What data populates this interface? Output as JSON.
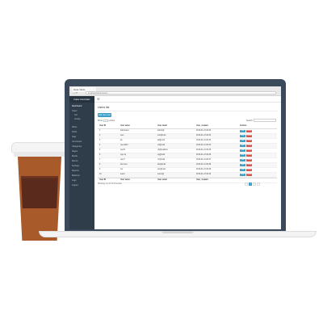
{
  "browser": {
    "tab_title": "Data Table",
    "address": "localhost/admin/users",
    "nav": "‹ › ⟳"
  },
  "sidebar": {
    "brand": "Data Controller",
    "items": [
      {
        "label": "Dashboard"
      },
      {
        "label": "Users"
      },
      {
        "label": "List"
      },
      {
        "label": "Create"
      },
      {
        "label": "Roles"
      },
      {
        "label": "Posts"
      },
      {
        "label": "Tags"
      },
      {
        "label": "Comments"
      },
      {
        "label": "Categories"
      },
      {
        "label": "Pages"
      },
      {
        "label": "Media"
      },
      {
        "label": "Menus"
      },
      {
        "label": "Settings"
      },
      {
        "label": "Reports"
      },
      {
        "label": "Backups"
      },
      {
        "label": "Logs"
      },
      {
        "label": "Logout"
      }
    ]
  },
  "topbar": {
    "menu_icon": "☰"
  },
  "main": {
    "title": "Users list",
    "add_button": "Add new user",
    "show_label": "Show",
    "entries_label": "entries",
    "search_label": "Search:",
    "search_value": "",
    "columns": [
      "User ID",
      "User name",
      "User email",
      "User_created",
      "Actions"
    ],
    "rows": [
      [
        "1",
        "adminuser",
        "admin@",
        "2016-01-21 09:32"
      ],
      [
        "2",
        "user",
        "test@mail",
        "2016-01-21 09:32"
      ],
      [
        "3",
        "ali",
        "ali@mail",
        "2016-01-21 09:33"
      ],
      [
        "4",
        "user4444",
        "u4@mail",
        "2016-01-21 09:34"
      ],
      [
        "5",
        "user5",
        "u5@mailbox",
        "2016-01-21 09:35"
      ],
      [
        "6",
        "qq1 1q",
        "qq@mail",
        "2016-01-21 09:36"
      ],
      [
        "7",
        "user7",
        "u7@mail",
        "2016-01-21 09:37"
      ],
      [
        "8",
        "last user",
        "last@mail",
        "2016-01-21 09:38"
      ],
      [
        "9",
        "usr",
        "usr@mail",
        "2016-01-21 09:39"
      ],
      [
        "10",
        "tester",
        "tester@",
        "2016-01-21 09:40"
      ]
    ],
    "footer": [
      "User ID",
      "User name",
      "User email",
      "User_created"
    ],
    "edit_label": "Edit",
    "delete_label": "Delete",
    "info": "Showing 1 to 10 of 20 entries",
    "pages": [
      "«",
      "1",
      "2",
      "»"
    ],
    "active_page": "1"
  },
  "colors": {
    "accent": "#3aa0c8",
    "danger": "#d9534f",
    "sidebar": "#2f3d4b",
    "bezel": "#3a4a5a"
  }
}
